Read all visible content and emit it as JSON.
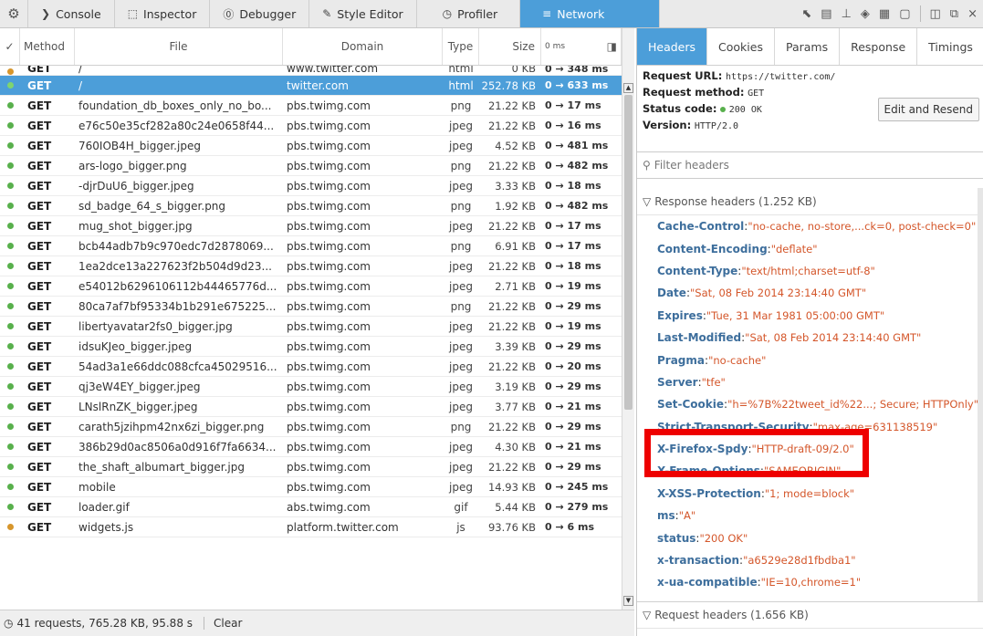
{
  "toolbar": {
    "tabs": [
      {
        "label": "Console",
        "icon": "chevron-right-icon",
        "glyph": "❯"
      },
      {
        "label": "Inspector",
        "icon": "inspector-icon",
        "glyph": "⬚"
      },
      {
        "label": "Debugger",
        "icon": "debugger-icon",
        "glyph": "⓪"
      },
      {
        "label": "Style Editor",
        "icon": "style-editor-icon",
        "glyph": "✎"
      },
      {
        "label": "Profiler",
        "icon": "profiler-icon",
        "glyph": "◷"
      },
      {
        "label": "Network",
        "icon": "network-icon",
        "glyph": "≡"
      }
    ],
    "active_tab": "Network"
  },
  "list": {
    "columns": {
      "method": "Method",
      "file": "File",
      "domain": "Domain",
      "type": "Type",
      "size": "Size",
      "time": "0 ms"
    },
    "top_partial": {
      "method": "GET",
      "file": "/",
      "domain": "www.twitter.com",
      "type": "html",
      "size": "0 KB",
      "time": "0 → 348 ms"
    },
    "rows": [
      {
        "method": "GET",
        "file": "/",
        "domain": "twitter.com",
        "type": "html",
        "size": "252.78 KB",
        "time": "0 → 633 ms",
        "selected": true,
        "status": "green"
      },
      {
        "method": "GET",
        "file": "foundation_db_boxes_only_no_bo...",
        "domain": "pbs.twimg.com",
        "type": "png",
        "size": "21.22 KB",
        "time": "0 → 17 ms",
        "status": "green"
      },
      {
        "method": "GET",
        "file": "e76c50e35cf282a80c24e0658f44...",
        "domain": "pbs.twimg.com",
        "type": "jpeg",
        "size": "21.22 KB",
        "time": "0 → 16 ms",
        "status": "green"
      },
      {
        "method": "GET",
        "file": "760IOB4H_bigger.jpeg",
        "domain": "pbs.twimg.com",
        "type": "jpeg",
        "size": "4.52 KB",
        "time": "0 → 481 ms",
        "status": "green"
      },
      {
        "method": "GET",
        "file": "ars-logo_bigger.png",
        "domain": "pbs.twimg.com",
        "type": "png",
        "size": "21.22 KB",
        "time": "0 → 482 ms",
        "status": "green"
      },
      {
        "method": "GET",
        "file": "-djrDuU6_bigger.jpeg",
        "domain": "pbs.twimg.com",
        "type": "jpeg",
        "size": "3.33 KB",
        "time": "0 → 18 ms",
        "status": "green"
      },
      {
        "method": "GET",
        "file": "sd_badge_64_s_bigger.png",
        "domain": "pbs.twimg.com",
        "type": "png",
        "size": "1.92 KB",
        "time": "0 → 482 ms",
        "status": "green"
      },
      {
        "method": "GET",
        "file": "mug_shot_bigger.jpg",
        "domain": "pbs.twimg.com",
        "type": "jpeg",
        "size": "21.22 KB",
        "time": "0 → 17 ms",
        "status": "green"
      },
      {
        "method": "GET",
        "file": "bcb44adb7b9c970edc7d2878069...",
        "domain": "pbs.twimg.com",
        "type": "png",
        "size": "6.91 KB",
        "time": "0 → 17 ms",
        "status": "green"
      },
      {
        "method": "GET",
        "file": "1ea2dce13a227623f2b504d9d23...",
        "domain": "pbs.twimg.com",
        "type": "jpeg",
        "size": "21.22 KB",
        "time": "0 → 18 ms",
        "status": "green"
      },
      {
        "method": "GET",
        "file": "e54012b6296106112b44465776d...",
        "domain": "pbs.twimg.com",
        "type": "jpeg",
        "size": "2.71 KB",
        "time": "0 → 19 ms",
        "status": "green"
      },
      {
        "method": "GET",
        "file": "80ca7af7bf95334b1b291e675225...",
        "domain": "pbs.twimg.com",
        "type": "png",
        "size": "21.22 KB",
        "time": "0 → 29 ms",
        "status": "green"
      },
      {
        "method": "GET",
        "file": "libertyavatar2fs0_bigger.jpg",
        "domain": "pbs.twimg.com",
        "type": "jpeg",
        "size": "21.22 KB",
        "time": "0 → 19 ms",
        "status": "green"
      },
      {
        "method": "GET",
        "file": "idsuKJeo_bigger.jpeg",
        "domain": "pbs.twimg.com",
        "type": "jpeg",
        "size": "3.39 KB",
        "time": "0 → 29 ms",
        "status": "green"
      },
      {
        "method": "GET",
        "file": "54ad3a1e66ddc088cfca45029516...",
        "domain": "pbs.twimg.com",
        "type": "jpeg",
        "size": "21.22 KB",
        "time": "0 → 20 ms",
        "status": "green"
      },
      {
        "method": "GET",
        "file": "qj3eW4EY_bigger.jpeg",
        "domain": "pbs.twimg.com",
        "type": "jpeg",
        "size": "3.19 KB",
        "time": "0 → 29 ms",
        "status": "green"
      },
      {
        "method": "GET",
        "file": "LNslRnZK_bigger.jpeg",
        "domain": "pbs.twimg.com",
        "type": "jpeg",
        "size": "3.77 KB",
        "time": "0 → 21 ms",
        "status": "green"
      },
      {
        "method": "GET",
        "file": "carath5jzihpm42nx6zi_bigger.png",
        "domain": "pbs.twimg.com",
        "type": "png",
        "size": "21.22 KB",
        "time": "0 → 29 ms",
        "status": "green"
      },
      {
        "method": "GET",
        "file": "386b29d0ac8506a0d916f7fa6634...",
        "domain": "pbs.twimg.com",
        "type": "jpeg",
        "size": "4.30 KB",
        "time": "0 → 21 ms",
        "status": "green"
      },
      {
        "method": "GET",
        "file": "the_shaft_albumart_bigger.jpg",
        "domain": "pbs.twimg.com",
        "type": "jpeg",
        "size": "21.22 KB",
        "time": "0 → 29 ms",
        "status": "green"
      },
      {
        "method": "GET",
        "file": "mobile",
        "domain": "pbs.twimg.com",
        "type": "jpeg",
        "size": "14.93 KB",
        "time": "0 → 245 ms",
        "status": "green"
      },
      {
        "method": "GET",
        "file": "loader.gif",
        "domain": "abs.twimg.com",
        "type": "gif",
        "size": "5.44 KB",
        "time": "0 → 279 ms",
        "status": "green"
      },
      {
        "method": "GET",
        "file": "widgets.js",
        "domain": "platform.twitter.com",
        "type": "js",
        "size": "93.76 KB",
        "time": "0 → 6 ms",
        "status": "orange"
      }
    ]
  },
  "statusbar": {
    "summary": "41 requests, 765.28 KB, 95.88 s",
    "clear": "Clear"
  },
  "details": {
    "tabs": [
      "Headers",
      "Cookies",
      "Params",
      "Response",
      "Timings"
    ],
    "active_tab": "Headers",
    "request_url_label": "Request URL:",
    "request_url": "https://twitter.com/",
    "request_method_label": "Request method:",
    "request_method": "GET",
    "status_code_label": "Status code:",
    "status_code": "200 OK",
    "version_label": "Version:",
    "version": "HTTP/2.0",
    "edit_resend": "Edit and Resend",
    "filter_placeholder": "Filter headers",
    "response_headers_title": "Response headers (1.252 KB)",
    "response_headers": [
      {
        "key": "Cache-Control",
        "value": "\"no-cache, no-store,...ck=0, post-check=0\""
      },
      {
        "key": "Content-Encoding",
        "value": "\"deflate\""
      },
      {
        "key": "Content-Type",
        "value": "\"text/html;charset=utf-8\""
      },
      {
        "key": "Date",
        "value": "\"Sat, 08 Feb 2014 23:14:40 GMT\""
      },
      {
        "key": "Expires",
        "value": "\"Tue, 31 Mar 1981 05:00:00 GMT\""
      },
      {
        "key": "Last-Modified",
        "value": "\"Sat, 08 Feb 2014 23:14:40 GMT\""
      },
      {
        "key": "Pragma",
        "value": "\"no-cache\""
      },
      {
        "key": "Server",
        "value": "\"tfe\""
      },
      {
        "key": "Set-Cookie",
        "value": "\"h=%7B%22tweet_id%22...; Secure; HTTPOnly\""
      },
      {
        "key": "Strict-Transport-Security",
        "value": "\"max-age=631138519\""
      },
      {
        "key": "X-Firefox-Spdy",
        "value": "\"HTTP-draft-09/2.0\""
      },
      {
        "key": "X-Frame-Options",
        "value": "\"SAMEORIGIN\""
      },
      {
        "key": "X-XSS-Protection",
        "value": "\"1; mode=block\""
      },
      {
        "key": "ms",
        "value": "\"A\""
      },
      {
        "key": "status",
        "value": "\"200 OK\""
      },
      {
        "key": "x-transaction",
        "value": "\"a6529e28d1fbdba1\""
      },
      {
        "key": "x-ua-compatible",
        "value": "\"IE=10,chrome=1\""
      }
    ],
    "request_headers_title": "Request headers (1.656 KB)"
  },
  "colors": {
    "accent": "#4c9ed9",
    "status_green": "#58b04c",
    "status_orange": "#d7962c",
    "highlight": "#ee0000"
  }
}
